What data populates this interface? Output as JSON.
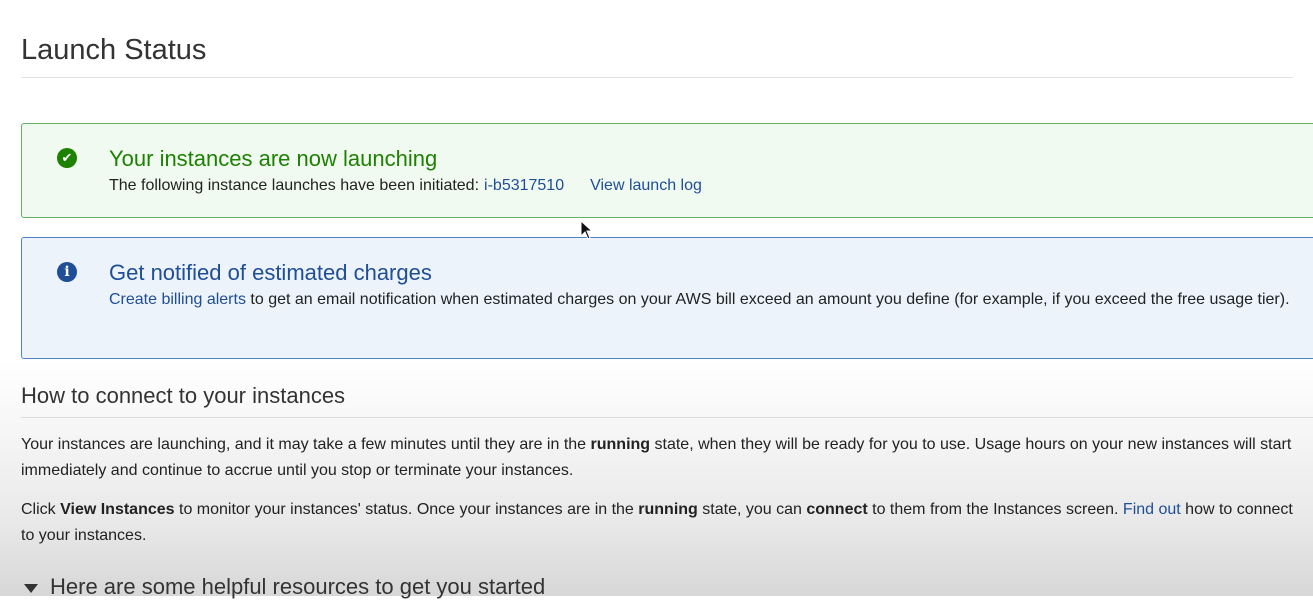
{
  "page": {
    "title": "Launch Status"
  },
  "success_alert": {
    "icon": "check-circle-icon",
    "color": "#1d8102",
    "heading": "Your instances are now launching",
    "body_text": "The following instance launches have been initiated:",
    "instance_id": "i-b5317510",
    "log_link": "View launch log"
  },
  "info_alert": {
    "icon": "info-circle-icon",
    "color": "#1f4e96",
    "heading": "Get notified of estimated charges",
    "link_text": "Create billing alerts",
    "body_text": "to get an email notification when estimated charges on your AWS bill exceed an amount you define (for example, if you exceed the free usage tier)."
  },
  "connect": {
    "heading": "How to connect to your instances",
    "p1": {
      "before": "Your instances are launching, and it may take a few minutes until they are in the ",
      "bold": "running",
      "after": " state, when they will be ready for you to use. Usage hours on your new instances will start immediately and continue to accrue until you stop or terminate your instances."
    },
    "p2": {
      "t1": "Click ",
      "b1": "View Instances",
      "t2": " to monitor your instances' status. Once your instances are in the ",
      "b2": "running",
      "t3": " state, you can ",
      "b3": "connect",
      "t4": " to them from the Instances screen. ",
      "link": "Find out",
      "t5": " how to connect to your instances."
    }
  },
  "resources": {
    "label": "Here are some helpful resources to get you started",
    "icon": "caret-down-icon"
  }
}
